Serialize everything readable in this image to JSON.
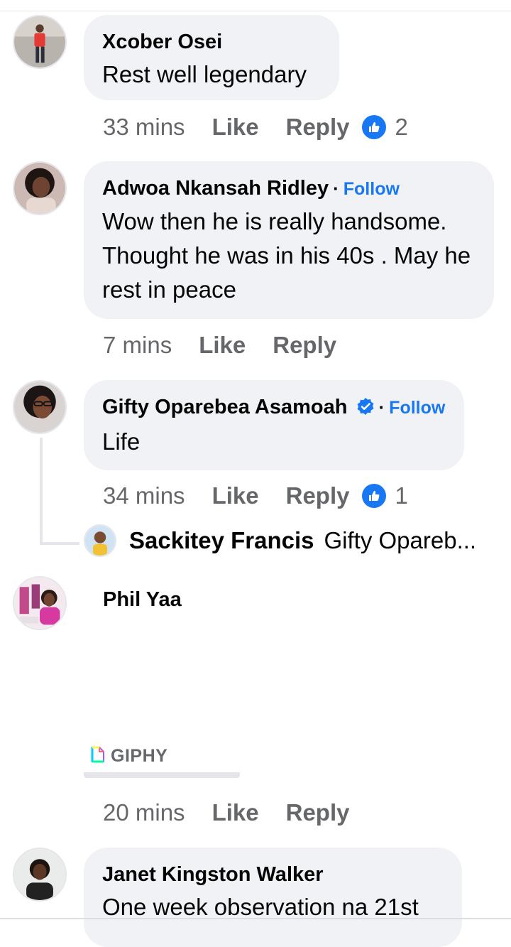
{
  "comments": [
    {
      "author": "Xcober Osei",
      "text": "Rest well legendary",
      "time": "33 mins",
      "like_label": "Like",
      "reply_label": "Reply",
      "reaction_count": "2"
    },
    {
      "author": "Adwoa Nkansah Ridley",
      "dot": "·",
      "follow_label": "Follow",
      "text": "Wow then he is really handsome. Thought he was in his 40s . May he rest in peace",
      "time": "7 mins",
      "like_label": "Like",
      "reply_label": "Reply"
    },
    {
      "author": "Gifty Oparebea Asamoah",
      "dot": "·",
      "follow_label": "Follow",
      "text": "Life",
      "time": "34 mins",
      "like_label": "Like",
      "reply_label": "Reply",
      "reaction_count": "1",
      "reply": {
        "author": "Sackitey Francis",
        "preview": "Gifty Opareb..."
      }
    },
    {
      "author": "Phil Yaa",
      "giphy_label": "GIPHY",
      "time": "20 mins",
      "like_label": "Like",
      "reply_label": "Reply"
    },
    {
      "author": "Janet Kingston Walker",
      "text": "One week observation na 21st"
    }
  ],
  "colors": {
    "bubble": "#f0f2f5",
    "follow": "#1877f2",
    "meta": "#65676b",
    "like_badge": "#1877f2"
  }
}
